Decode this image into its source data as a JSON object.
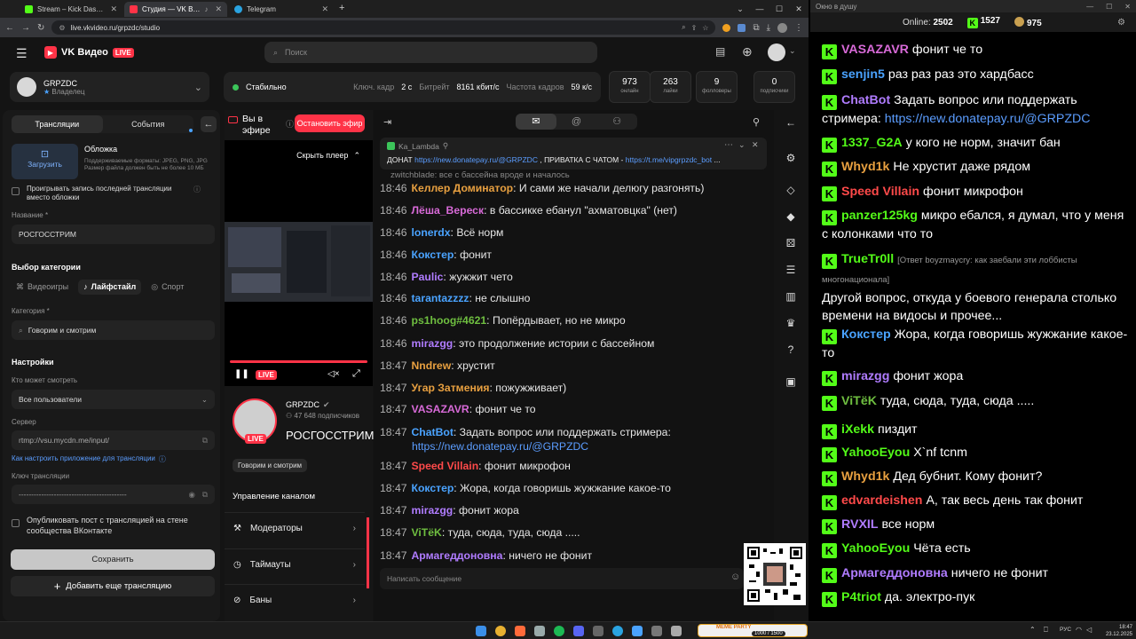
{
  "browser": {
    "tabs": [
      {
        "label": "Stream – Kick Dashboard",
        "color": "#53fc18"
      },
      {
        "label": "Студия — VK Видео Live",
        "color": "#ff3347"
      },
      {
        "label": "Telegram",
        "color": "#2aa3e0"
      }
    ],
    "url": "live.vkvideo.ru/grpzdc/studio"
  },
  "vk": {
    "brand": "VK Видео",
    "live_badge": "LIVE",
    "search_placeholder": "Поиск",
    "channel": {
      "name": "GRPZDC",
      "role": "Владелец"
    },
    "status": {
      "state": "Стабильно",
      "keyframe_label": "Ключ. кадр",
      "keyframe_value": "2 с",
      "bitrate_label": "Битрейт",
      "bitrate_value": "8161 кбит/с",
      "fps_label": "Частота кадров",
      "fps_value": "59 к/с"
    },
    "stats": [
      {
        "value": "973",
        "label": "онлайн"
      },
      {
        "value": "263",
        "label": "лайки"
      },
      {
        "value": "9",
        "label": "фолловеры"
      },
      {
        "value": "0",
        "label": "подписчики"
      }
    ],
    "left": {
      "tab_streams": "Трансляции",
      "tab_events": "События",
      "cover_title": "Обложка",
      "cover_desc": "Поддерживаемые форматы: JPEG, PNG, JPG Размер файла должен быть не более 10 МБ",
      "upload_label": "Загрузить",
      "record_cover_label": "Проигрывать запись последней трансляции вместо обложки",
      "name_label": "Название *",
      "name_value": "РОСГОССТРИМ",
      "category_section": "Выбор категории",
      "cat_games": "Видеоигры",
      "cat_lifestyle": "Лайфстайл",
      "cat_sport": "Спорт",
      "category_label": "Категория *",
      "category_value": "Говорим и смотрим",
      "settings_section": "Настройки",
      "who_label": "Кто может смотреть",
      "who_value": "Все пользователи",
      "server_label": "Сервер",
      "server_value": "rtmp://vsu.mycdn.me/input/",
      "howto_link": "Как настроить приложение для трансляции",
      "key_label": "Ключ трансляции",
      "key_value": "-------------------------------------------",
      "publish_label": "Опубликовать пост с трансляцией на стене сообщества ВКонтакте",
      "save_label": "Сохранить",
      "add_stream_label": "Добавить еще трансляцию"
    },
    "player": {
      "on_air": "Вы в эфире",
      "stop_label": "Остановить эфир",
      "hide_player": "Скрыть плеер",
      "live": "LIVE",
      "channel_name": "GRPZDC",
      "subscribers": "47 648 подписчиков",
      "title": "РОСГОССТРИМ",
      "category_chip": "Говорим и смотрим"
    },
    "manage": {
      "header": "Управление каналом",
      "items": [
        "Модераторы",
        "Таймауты",
        "Баны"
      ]
    },
    "chat": {
      "pinned_author": "Ka_Lambda",
      "pinned_prefix": "ДОНАТ",
      "pinned_link1": "https://new.donatepay.ru/@GRPZDC",
      "pinned_mid": ", ПРИВАТКА С ЧАТОМ -",
      "pinned_link2": "https://t.me/vipgrpzdc_bot",
      "pinned_tail": "...",
      "faded": "zwitchblade: все с бассейна вроде и началось",
      "input_placeholder": "Написать сообщение",
      "messages": [
        {
          "time": "18:46",
          "user": "Келлер Доминатор",
          "color": "#e8a040",
          "text": "И сами же начали делюгу разгонять)"
        },
        {
          "time": "18:46",
          "user": "Лёша_Вереск",
          "color": "#d86ad8",
          "text": "в бассикке ебанул \"ахматовцка\" (нет)"
        },
        {
          "time": "18:46",
          "user": "lonerdx",
          "color": "#4aa3ff",
          "text": "Всё норм"
        },
        {
          "time": "18:46",
          "user": "Кокстер",
          "color": "#4aa3ff",
          "text": "фонит"
        },
        {
          "time": "18:46",
          "user": "Paulic",
          "color": "#b07cff",
          "text": "жужжит чето"
        },
        {
          "time": "18:46",
          "user": "tarantazzzz",
          "color": "#4aa3ff",
          "text": "не слышно"
        },
        {
          "time": "18:46",
          "user": "ps1hoog#4621",
          "color": "#6fbf40",
          "text": "Попёрдывает, но не микро"
        },
        {
          "time": "18:46",
          "user": "mirazgg",
          "color": "#b07cff",
          "text": "это продолжение истории с бассейном"
        },
        {
          "time": "18:47",
          "user": "Nndrew",
          "color": "#e8a040",
          "text": "хрустит"
        },
        {
          "time": "18:47",
          "user": "Угар Затмения",
          "color": "#e8a040",
          "text": "пожужживает)"
        },
        {
          "time": "18:47",
          "user": "VASAZAVR",
          "color": "#d86ad8",
          "text": "фонит че то"
        },
        {
          "time": "18:47",
          "user": "ChatBot",
          "color": "#4aa3ff",
          "text": "Задать вопрос или поддержать стримера:",
          "link": "https://new.donatepay.ru/@GRPZDC"
        },
        {
          "time": "18:47",
          "user": "Speed Villain",
          "color": "#ff4a4a",
          "text": "фонит микрофон"
        },
        {
          "time": "18:47",
          "user": "Кокстер",
          "color": "#4aa3ff",
          "text": "Жора, когда говоришь жужжание какое-то"
        },
        {
          "time": "18:47",
          "user": "mirazgg",
          "color": "#b07cff",
          "text": "фонит жора"
        },
        {
          "time": "18:47",
          "user": "ViTёK",
          "color": "#6fbf40",
          "text": "туда, сюда, туда, сюда ....."
        },
        {
          "time": "18:47",
          "user": "Армагеддоновна",
          "color": "#b07cff",
          "text": "ничего не фонит"
        }
      ]
    }
  },
  "kick": {
    "window_title": "Окно в душу",
    "online_label": "Online:",
    "online_value": "2502",
    "followers": "1527",
    "subs": "975",
    "messages": [
      {
        "user": "VASAZAVR",
        "color": "#d86ad8",
        "text": "фонит че то"
      },
      {
        "user": "senjin5",
        "color": "#4aa3ff",
        "text": "раз раз раз это хардбасс"
      },
      {
        "user": "ChatBot",
        "color": "#b07cff",
        "text": "Задать вопрос или поддержать стримера:",
        "link": "https://new.donatepay.ru/@GRPZDC"
      },
      {
        "user": "1337_G2A",
        "color": "#53fc18",
        "text": "у кого не норм, значит бан"
      },
      {
        "user": "Whyd1k",
        "color": "#e8a040",
        "text": "Не хрустит даже рядом"
      },
      {
        "user": "Speed Villain",
        "color": "#ff4a4a",
        "text": "фонит микрофон"
      },
      {
        "user": "panzer125kg",
        "color": "#53fc18",
        "text": "микро ебался, я думал, что у меня с колонками что то"
      },
      {
        "user": "TrueTr0ll",
        "color": "#53fc18",
        "reply": "[Ответ boyzmaycry: как заебали эти лоббисты многонационала]",
        "text": "Другой вопрос, откуда у боевого генерала столько времени на видосы и прочее..."
      },
      {
        "user": "Кокстер",
        "color": "#4aa3ff",
        "text": "Жора, когда говоришь жужжание какое-то"
      },
      {
        "user": "mirazgg",
        "color": "#b07cff",
        "text": "фонит жора"
      },
      {
        "user": "ViTёK",
        "color": "#6fbf40",
        "text": "туда, сюда, туда, сюда ....."
      },
      {
        "user": "iXekk",
        "color": "#53fc18",
        "text": "пиздит"
      },
      {
        "user": "YahooEyou",
        "color": "#53fc18",
        "text": "X`nf tcnm"
      },
      {
        "user": "Whyd1k",
        "color": "#e8a040",
        "text": "Дед бубнит. Кому фонит?"
      },
      {
        "user": "edvardeishen",
        "color": "#ff4a4a",
        "text": "А, так весь день так фонит"
      },
      {
        "user": "RVXIL",
        "color": "#b07cff",
        "text": "все норм"
      },
      {
        "user": "YahooEyou",
        "color": "#53fc18",
        "text": "Чёта есть"
      },
      {
        "user": "Армагеддоновна",
        "color": "#b07cff",
        "text": "ничего не фонит"
      },
      {
        "user": "P4triot",
        "color": "#53fc18",
        "text": "да. электро-пук"
      }
    ]
  },
  "taskbar": {
    "lang": "РУС",
    "time": "18:47",
    "date": "23.12.2025",
    "widget": "MEME PARTY",
    "widget_value": "1000 / 1500"
  }
}
